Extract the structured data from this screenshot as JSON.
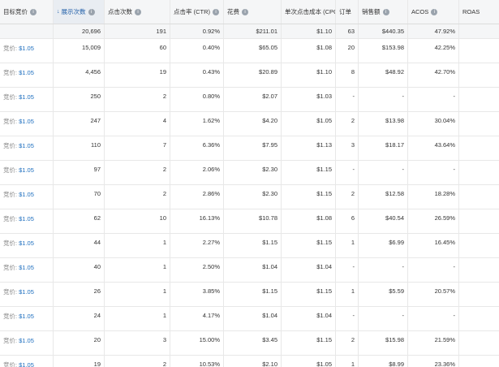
{
  "columns": [
    {
      "label": "目标竞价",
      "info": true
    },
    {
      "label": "展示次数",
      "info": true,
      "sorted": true,
      "sort_arrow": "↓"
    },
    {
      "label": "点击次数",
      "info": true
    },
    {
      "label": "点击率 (CTR)",
      "info": true
    },
    {
      "label": "花费",
      "info": true
    },
    {
      "label": "单次点击成本 (CPC)",
      "info": false
    },
    {
      "label": "订单",
      "info": false
    },
    {
      "label": "销售额",
      "info": true
    },
    {
      "label": "ACOS",
      "info": true
    },
    {
      "label": "ROAS",
      "info": false
    }
  ],
  "info_glyph": "i",
  "summary": [
    "",
    "20,696",
    "191",
    "0.92%",
    "$211.01",
    "$1.10",
    "63",
    "$440.35",
    "47.92%",
    ""
  ],
  "bid_label": "竞价:",
  "rows": [
    {
      "bid": "$1.05",
      "cells": [
        "15,009",
        "60",
        "0.40%",
        "$65.05",
        "$1.08",
        "20",
        "$153.98",
        "42.25%",
        ""
      ]
    },
    {
      "bid": "$1.05",
      "cells": [
        "4,456",
        "19",
        "0.43%",
        "$20.89",
        "$1.10",
        "8",
        "$48.92",
        "42.70%",
        ""
      ]
    },
    {
      "bid": "$1.05",
      "cells": [
        "250",
        "2",
        "0.80%",
        "$2.07",
        "$1.03",
        "-",
        "-",
        "-",
        ""
      ]
    },
    {
      "bid": "$1.05",
      "cells": [
        "247",
        "4",
        "1.62%",
        "$4.20",
        "$1.05",
        "2",
        "$13.98",
        "30.04%",
        ""
      ]
    },
    {
      "bid": "$1.05",
      "cells": [
        "110",
        "7",
        "6.36%",
        "$7.95",
        "$1.13",
        "3",
        "$18.17",
        "43.64%",
        ""
      ]
    },
    {
      "bid": "$1.05",
      "cells": [
        "97",
        "2",
        "2.06%",
        "$2.30",
        "$1.15",
        "-",
        "-",
        "-",
        ""
      ]
    },
    {
      "bid": "$1.05",
      "cells": [
        "70",
        "2",
        "2.86%",
        "$2.30",
        "$1.15",
        "2",
        "$12.58",
        "18.28%",
        ""
      ]
    },
    {
      "bid": "$1.05",
      "cells": [
        "62",
        "10",
        "16.13%",
        "$10.78",
        "$1.08",
        "6",
        "$40.54",
        "26.59%",
        ""
      ]
    },
    {
      "bid": "$1.05",
      "cells": [
        "44",
        "1",
        "2.27%",
        "$1.15",
        "$1.15",
        "1",
        "$6.99",
        "16.45%",
        ""
      ]
    },
    {
      "bid": "$1.05",
      "cells": [
        "40",
        "1",
        "2.50%",
        "$1.04",
        "$1.04",
        "-",
        "-",
        "-",
        ""
      ]
    },
    {
      "bid": "$1.05",
      "cells": [
        "26",
        "1",
        "3.85%",
        "$1.15",
        "$1.15",
        "1",
        "$5.59",
        "20.57%",
        ""
      ]
    },
    {
      "bid": "$1.05",
      "cells": [
        "24",
        "1",
        "4.17%",
        "$1.04",
        "$1.04",
        "-",
        "-",
        "-",
        ""
      ]
    },
    {
      "bid": "$1.05",
      "cells": [
        "20",
        "3",
        "15.00%",
        "$3.45",
        "$1.15",
        "2",
        "$15.98",
        "21.59%",
        ""
      ]
    },
    {
      "bid": "$1.05",
      "cells": [
        "19",
        "2",
        "10.53%",
        "$2.10",
        "$1.05",
        "1",
        "$8.99",
        "23.36%",
        ""
      ]
    }
  ]
}
